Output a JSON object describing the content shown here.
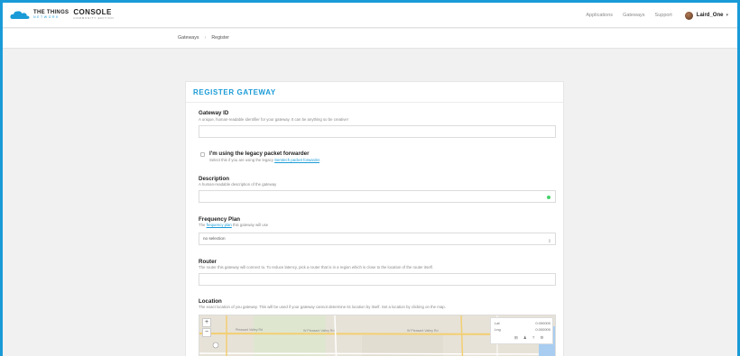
{
  "app": {
    "logo": {
      "ttn": "THE THINGS",
      "network": "NETWORK",
      "console": "CONSOLE",
      "edition": "COMMUNITY EDITION"
    },
    "nav": [
      {
        "label": "Applications"
      },
      {
        "label": "Gateways"
      },
      {
        "label": "Support"
      }
    ],
    "user": {
      "name": "Laird_One",
      "caret": "▾"
    }
  },
  "breadcrumb": {
    "items": [
      "Gateways",
      "Register"
    ],
    "separator": "›"
  },
  "form": {
    "title": "REGISTER GATEWAY",
    "gateway_id": {
      "label": "Gateway ID",
      "help": "A unique, human-readable identifier for your gateway. It can be anything so be creative!",
      "value": ""
    },
    "legacy": {
      "label": "I'm using the legacy packet forwarder",
      "help_prefix": "Select this if you are using the legacy ",
      "help_link": "Semtech packet forwarder",
      "help_suffix": ".",
      "checked": false
    },
    "description": {
      "label": "Description",
      "help": "A human-readable description of the gateway",
      "value": ""
    },
    "frequency_plan": {
      "label": "Frequency Plan",
      "help_prefix": "The ",
      "help_link": "frequency plan",
      "help_suffix": " this gateway will use",
      "selected": "no selection",
      "caret": "⇕"
    },
    "router": {
      "label": "Router",
      "help": "The router this gateway will connect to. To reduce latency, pick a router that is in a region which is close to the location of the router itself.",
      "value": ""
    },
    "location": {
      "label": "Location",
      "help": "The exact location of you gateway. This will be used if your gateway cannot determine its location by itself. Set a location by clicking on the map.",
      "zoom_in": "+",
      "zoom_out": "−",
      "lat_label": "Lat",
      "lat_value": "0.000000",
      "lng_label": "Lng",
      "lng_value": "0.000000",
      "tools": [
        "⊞",
        "♟",
        "?",
        "⚙"
      ],
      "map_labels": [
        "Pleasant Valley Rd",
        "W Pleasant Valley Rd",
        "W Pleasant Valley Rd"
      ]
    }
  },
  "colors": {
    "accent": "#1a9bd7",
    "status_ok": "#44d26b"
  }
}
